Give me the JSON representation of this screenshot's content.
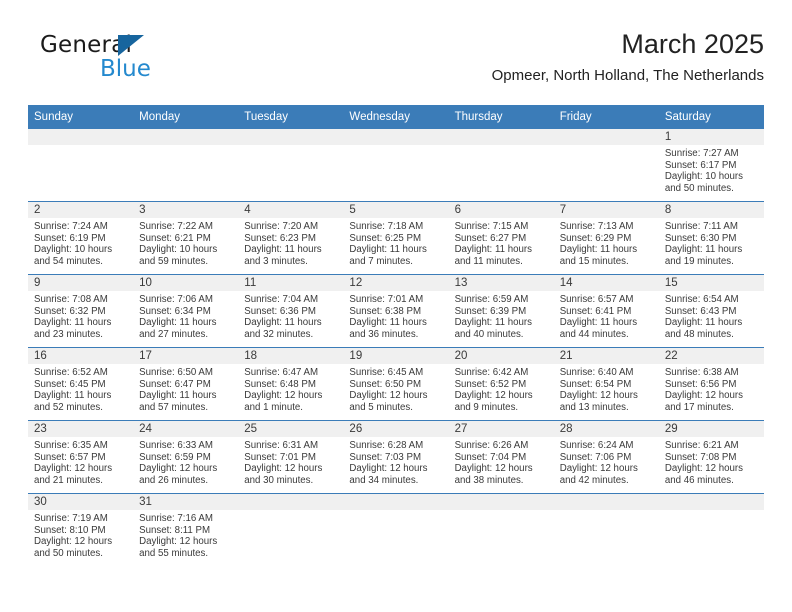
{
  "brand": {
    "name_top": "General",
    "name_bottom": "Blue",
    "accent_color": "#2489ce",
    "triangle_color": "#17659e"
  },
  "header": {
    "title": "March 2025",
    "subtitle": "Opmeer, North Holland, The Netherlands"
  },
  "theme": {
    "header_row_bg": "#3b7cb8",
    "daynum_strip_bg": "#f0f0f0",
    "grid_line": "#3b7cb8",
    "text": "#3a3a3a"
  },
  "weekday_headers": [
    "Sunday",
    "Monday",
    "Tuesday",
    "Wednesday",
    "Thursday",
    "Friday",
    "Saturday"
  ],
  "weeks": [
    [
      {
        "day": "",
        "sunrise": "",
        "sunset": "",
        "daylight_1": "",
        "daylight_2": "",
        "empty": true
      },
      {
        "day": "",
        "sunrise": "",
        "sunset": "",
        "daylight_1": "",
        "daylight_2": "",
        "empty": true
      },
      {
        "day": "",
        "sunrise": "",
        "sunset": "",
        "daylight_1": "",
        "daylight_2": "",
        "empty": true
      },
      {
        "day": "",
        "sunrise": "",
        "sunset": "",
        "daylight_1": "",
        "daylight_2": "",
        "empty": true
      },
      {
        "day": "",
        "sunrise": "",
        "sunset": "",
        "daylight_1": "",
        "daylight_2": "",
        "empty": true
      },
      {
        "day": "",
        "sunrise": "",
        "sunset": "",
        "daylight_1": "",
        "daylight_2": "",
        "empty": true
      },
      {
        "day": "1",
        "sunrise": "Sunrise: 7:27 AM",
        "sunset": "Sunset: 6:17 PM",
        "daylight_1": "Daylight: 10 hours",
        "daylight_2": "and 50 minutes.",
        "empty": false
      }
    ],
    [
      {
        "day": "2",
        "sunrise": "Sunrise: 7:24 AM",
        "sunset": "Sunset: 6:19 PM",
        "daylight_1": "Daylight: 10 hours",
        "daylight_2": "and 54 minutes.",
        "empty": false
      },
      {
        "day": "3",
        "sunrise": "Sunrise: 7:22 AM",
        "sunset": "Sunset: 6:21 PM",
        "daylight_1": "Daylight: 10 hours",
        "daylight_2": "and 59 minutes.",
        "empty": false
      },
      {
        "day": "4",
        "sunrise": "Sunrise: 7:20 AM",
        "sunset": "Sunset: 6:23 PM",
        "daylight_1": "Daylight: 11 hours",
        "daylight_2": "and 3 minutes.",
        "empty": false
      },
      {
        "day": "5",
        "sunrise": "Sunrise: 7:18 AM",
        "sunset": "Sunset: 6:25 PM",
        "daylight_1": "Daylight: 11 hours",
        "daylight_2": "and 7 minutes.",
        "empty": false
      },
      {
        "day": "6",
        "sunrise": "Sunrise: 7:15 AM",
        "sunset": "Sunset: 6:27 PM",
        "daylight_1": "Daylight: 11 hours",
        "daylight_2": "and 11 minutes.",
        "empty": false
      },
      {
        "day": "7",
        "sunrise": "Sunrise: 7:13 AM",
        "sunset": "Sunset: 6:29 PM",
        "daylight_1": "Daylight: 11 hours",
        "daylight_2": "and 15 minutes.",
        "empty": false
      },
      {
        "day": "8",
        "sunrise": "Sunrise: 7:11 AM",
        "sunset": "Sunset: 6:30 PM",
        "daylight_1": "Daylight: 11 hours",
        "daylight_2": "and 19 minutes.",
        "empty": false
      }
    ],
    [
      {
        "day": "9",
        "sunrise": "Sunrise: 7:08 AM",
        "sunset": "Sunset: 6:32 PM",
        "daylight_1": "Daylight: 11 hours",
        "daylight_2": "and 23 minutes.",
        "empty": false
      },
      {
        "day": "10",
        "sunrise": "Sunrise: 7:06 AM",
        "sunset": "Sunset: 6:34 PM",
        "daylight_1": "Daylight: 11 hours",
        "daylight_2": "and 27 minutes.",
        "empty": false
      },
      {
        "day": "11",
        "sunrise": "Sunrise: 7:04 AM",
        "sunset": "Sunset: 6:36 PM",
        "daylight_1": "Daylight: 11 hours",
        "daylight_2": "and 32 minutes.",
        "empty": false
      },
      {
        "day": "12",
        "sunrise": "Sunrise: 7:01 AM",
        "sunset": "Sunset: 6:38 PM",
        "daylight_1": "Daylight: 11 hours",
        "daylight_2": "and 36 minutes.",
        "empty": false
      },
      {
        "day": "13",
        "sunrise": "Sunrise: 6:59 AM",
        "sunset": "Sunset: 6:39 PM",
        "daylight_1": "Daylight: 11 hours",
        "daylight_2": "and 40 minutes.",
        "empty": false
      },
      {
        "day": "14",
        "sunrise": "Sunrise: 6:57 AM",
        "sunset": "Sunset: 6:41 PM",
        "daylight_1": "Daylight: 11 hours",
        "daylight_2": "and 44 minutes.",
        "empty": false
      },
      {
        "day": "15",
        "sunrise": "Sunrise: 6:54 AM",
        "sunset": "Sunset: 6:43 PM",
        "daylight_1": "Daylight: 11 hours",
        "daylight_2": "and 48 minutes.",
        "empty": false
      }
    ],
    [
      {
        "day": "16",
        "sunrise": "Sunrise: 6:52 AM",
        "sunset": "Sunset: 6:45 PM",
        "daylight_1": "Daylight: 11 hours",
        "daylight_2": "and 52 minutes.",
        "empty": false
      },
      {
        "day": "17",
        "sunrise": "Sunrise: 6:50 AM",
        "sunset": "Sunset: 6:47 PM",
        "daylight_1": "Daylight: 11 hours",
        "daylight_2": "and 57 minutes.",
        "empty": false
      },
      {
        "day": "18",
        "sunrise": "Sunrise: 6:47 AM",
        "sunset": "Sunset: 6:48 PM",
        "daylight_1": "Daylight: 12 hours",
        "daylight_2": "and 1 minute.",
        "empty": false
      },
      {
        "day": "19",
        "sunrise": "Sunrise: 6:45 AM",
        "sunset": "Sunset: 6:50 PM",
        "daylight_1": "Daylight: 12 hours",
        "daylight_2": "and 5 minutes.",
        "empty": false
      },
      {
        "day": "20",
        "sunrise": "Sunrise: 6:42 AM",
        "sunset": "Sunset: 6:52 PM",
        "daylight_1": "Daylight: 12 hours",
        "daylight_2": "and 9 minutes.",
        "empty": false
      },
      {
        "day": "21",
        "sunrise": "Sunrise: 6:40 AM",
        "sunset": "Sunset: 6:54 PM",
        "daylight_1": "Daylight: 12 hours",
        "daylight_2": "and 13 minutes.",
        "empty": false
      },
      {
        "day": "22",
        "sunrise": "Sunrise: 6:38 AM",
        "sunset": "Sunset: 6:56 PM",
        "daylight_1": "Daylight: 12 hours",
        "daylight_2": "and 17 minutes.",
        "empty": false
      }
    ],
    [
      {
        "day": "23",
        "sunrise": "Sunrise: 6:35 AM",
        "sunset": "Sunset: 6:57 PM",
        "daylight_1": "Daylight: 12 hours",
        "daylight_2": "and 21 minutes.",
        "empty": false
      },
      {
        "day": "24",
        "sunrise": "Sunrise: 6:33 AM",
        "sunset": "Sunset: 6:59 PM",
        "daylight_1": "Daylight: 12 hours",
        "daylight_2": "and 26 minutes.",
        "empty": false
      },
      {
        "day": "25",
        "sunrise": "Sunrise: 6:31 AM",
        "sunset": "Sunset: 7:01 PM",
        "daylight_1": "Daylight: 12 hours",
        "daylight_2": "and 30 minutes.",
        "empty": false
      },
      {
        "day": "26",
        "sunrise": "Sunrise: 6:28 AM",
        "sunset": "Sunset: 7:03 PM",
        "daylight_1": "Daylight: 12 hours",
        "daylight_2": "and 34 minutes.",
        "empty": false
      },
      {
        "day": "27",
        "sunrise": "Sunrise: 6:26 AM",
        "sunset": "Sunset: 7:04 PM",
        "daylight_1": "Daylight: 12 hours",
        "daylight_2": "and 38 minutes.",
        "empty": false
      },
      {
        "day": "28",
        "sunrise": "Sunrise: 6:24 AM",
        "sunset": "Sunset: 7:06 PM",
        "daylight_1": "Daylight: 12 hours",
        "daylight_2": "and 42 minutes.",
        "empty": false
      },
      {
        "day": "29",
        "sunrise": "Sunrise: 6:21 AM",
        "sunset": "Sunset: 7:08 PM",
        "daylight_1": "Daylight: 12 hours",
        "daylight_2": "and 46 minutes.",
        "empty": false
      }
    ],
    [
      {
        "day": "30",
        "sunrise": "Sunrise: 7:19 AM",
        "sunset": "Sunset: 8:10 PM",
        "daylight_1": "Daylight: 12 hours",
        "daylight_2": "and 50 minutes.",
        "empty": false
      },
      {
        "day": "31",
        "sunrise": "Sunrise: 7:16 AM",
        "sunset": "Sunset: 8:11 PM",
        "daylight_1": "Daylight: 12 hours",
        "daylight_2": "and 55 minutes.",
        "empty": false
      },
      {
        "day": "",
        "sunrise": "",
        "sunset": "",
        "daylight_1": "",
        "daylight_2": "",
        "empty": true
      },
      {
        "day": "",
        "sunrise": "",
        "sunset": "",
        "daylight_1": "",
        "daylight_2": "",
        "empty": true
      },
      {
        "day": "",
        "sunrise": "",
        "sunset": "",
        "daylight_1": "",
        "daylight_2": "",
        "empty": true
      },
      {
        "day": "",
        "sunrise": "",
        "sunset": "",
        "daylight_1": "",
        "daylight_2": "",
        "empty": true
      },
      {
        "day": "",
        "sunrise": "",
        "sunset": "",
        "daylight_1": "",
        "daylight_2": "",
        "empty": true
      }
    ]
  ]
}
